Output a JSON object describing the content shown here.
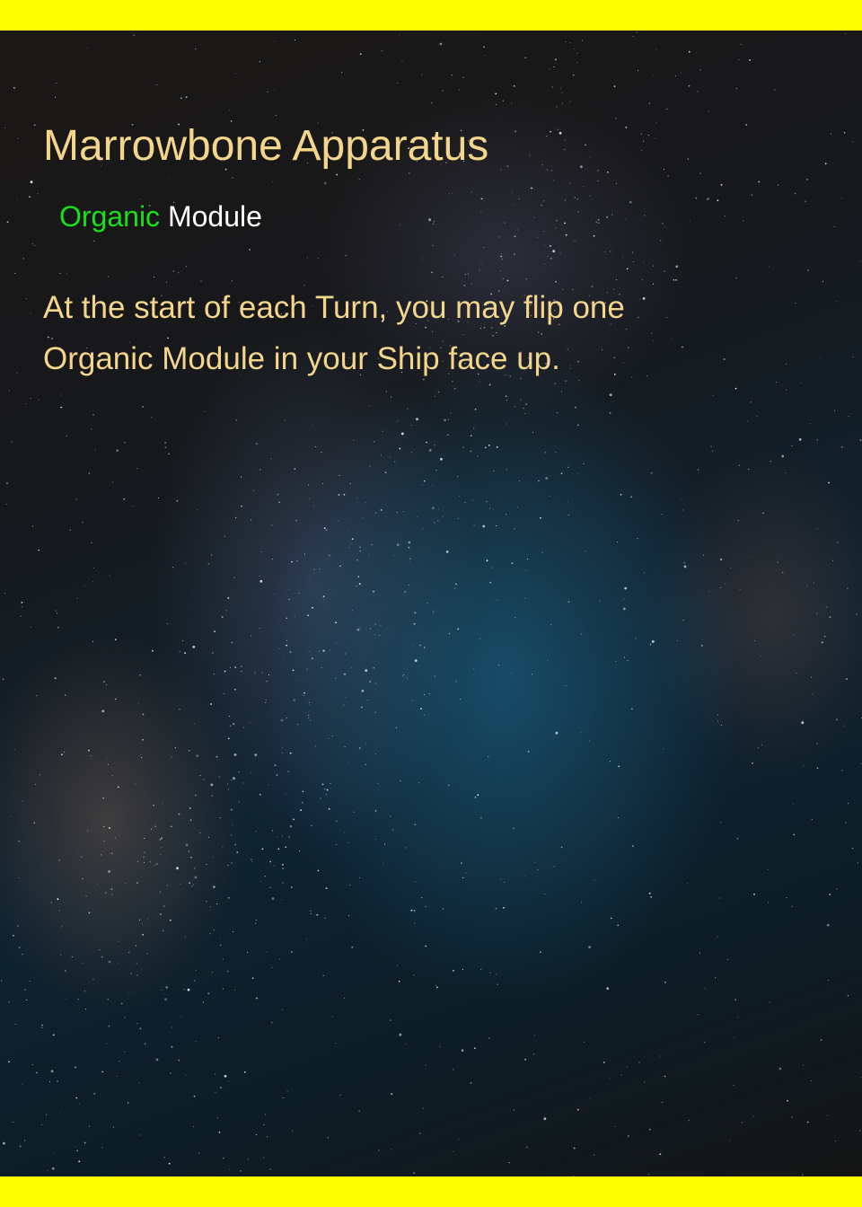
{
  "card": {
    "title": "Marrowbone Apparatus",
    "type_keyword": "Organic",
    "type_name": "Module",
    "rules_line_1": "At the start of each Turn, you may flip one",
    "rules_line_2": "Organic Module in your Ship face up."
  },
  "colors": {
    "border": "#ffff00",
    "title": "#f3d58b",
    "type_keyword": "#19e019",
    "type_name": "#ffffff",
    "rules_text": "#f3d58b"
  }
}
